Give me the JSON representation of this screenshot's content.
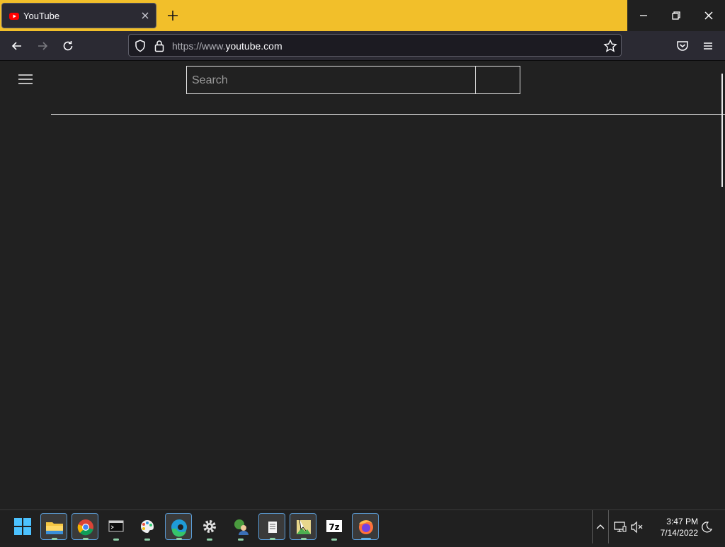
{
  "browser": {
    "tab_title": "YouTube",
    "url_prefix": "https://www.",
    "url_domain": "youtube.com",
    "theme_color": "#f2bf2a"
  },
  "page": {
    "search_placeholder": "Search"
  },
  "taskbar": {
    "apps": [
      "start-icon",
      "file-explorer-icon",
      "chrome-icon",
      "terminal-icon",
      "paint-icon",
      "edge-icon",
      "settings-icon",
      "network-user-icon",
      "notepad-icon",
      "image-editor-icon",
      "7zip-icon",
      "firefox-icon"
    ],
    "sevenzip_label": "7z",
    "time": "3:47 PM",
    "date": "7/14/2022"
  }
}
